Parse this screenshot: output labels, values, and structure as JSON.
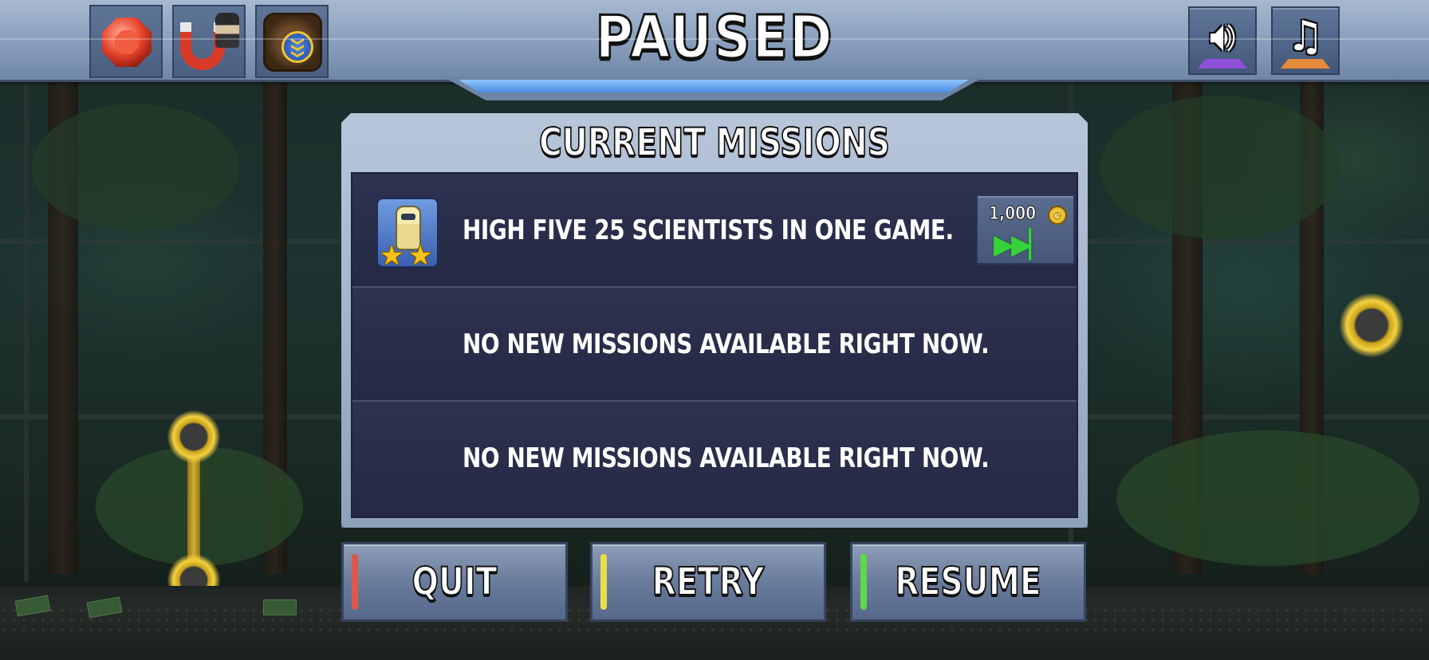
{
  "header": {
    "title": "PAUSED",
    "powerups": [
      {
        "icon": "red-gem-icon"
      },
      {
        "icon": "magnet-icon"
      },
      {
        "icon": "upgrade-crate-icon"
      }
    ],
    "sound_icon": "speaker-icon",
    "music_icon": "music-note-icon"
  },
  "missions_panel": {
    "title": "CURRENT MISSIONS",
    "missions": [
      {
        "text": "HIGH FIVE 25 SCIENTISTS IN ONE GAME.",
        "icon": "scientist-mission-icon",
        "stars": 2,
        "skip_cost": "1,000",
        "skip_icon": "fast-forward-icon"
      },
      {
        "text": "NO NEW MISSIONS AVAILABLE RIGHT NOW."
      },
      {
        "text": "NO NEW MISSIONS AVAILABLE RIGHT NOW."
      }
    ]
  },
  "buttons": {
    "quit": "QUIT",
    "retry": "RETRY",
    "resume": "RESUME"
  },
  "colors": {
    "quit_accent": "#e0574a",
    "retry_accent": "#e8de4a",
    "resume_accent": "#5fd84a",
    "sound_base": "#8f4fd8",
    "music_base": "#e48a3a"
  }
}
